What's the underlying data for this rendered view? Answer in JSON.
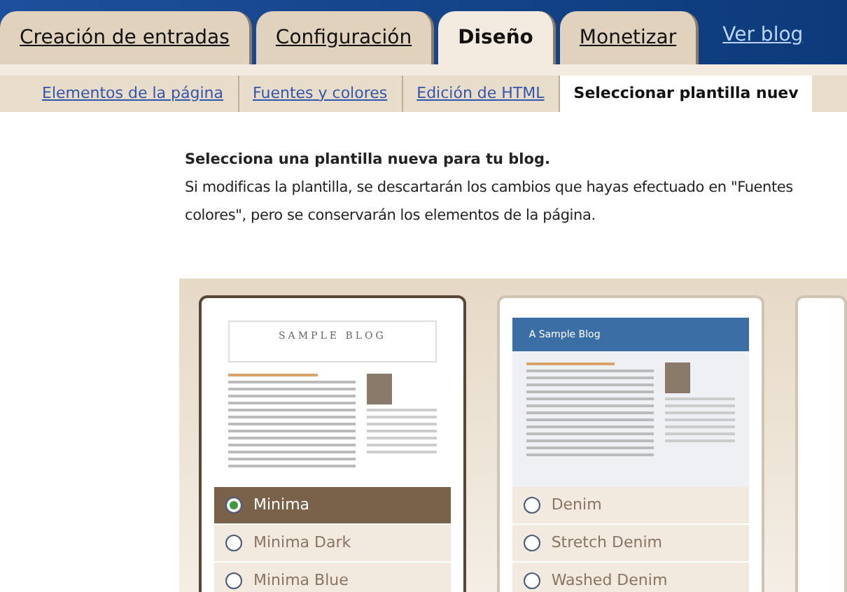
{
  "tabs": [
    {
      "label": "Creación de entradas",
      "selected": false
    },
    {
      "label": "Configuración",
      "selected": false
    },
    {
      "label": "Diseño",
      "selected": true
    },
    {
      "label": "Monetizar",
      "selected": false
    }
  ],
  "view_blog_link": "Ver blog",
  "subtabs": [
    {
      "label": "Elementos de la página",
      "selected": false
    },
    {
      "label": "Fuentes y colores",
      "selected": false
    },
    {
      "label": "Edición de HTML",
      "selected": false
    },
    {
      "label": "Seleccionar plantilla nuev",
      "selected": true
    }
  ],
  "intro": {
    "heading": "Selecciona una plantilla nueva para tu blog.",
    "note_lines": [
      "Si modificas la plantilla, se descartarán los cambios que hayas efectuado en \"Fuentes",
      "colores\", pero se conservarán los elementos de la página."
    ]
  },
  "templates": [
    {
      "kind": "minima",
      "preview_title": "SAMPLE BLOG",
      "options": [
        {
          "label": "Minima",
          "selected": true
        },
        {
          "label": "Minima Dark",
          "selected": false
        },
        {
          "label": "Minima Blue",
          "selected": false
        }
      ]
    },
    {
      "kind": "denim",
      "preview_title": "A Sample Blog",
      "options": [
        {
          "label": "Denim",
          "selected": false
        },
        {
          "label": "Stretch Denim",
          "selected": false
        },
        {
          "label": "Washed Denim",
          "selected": false
        }
      ]
    }
  ]
}
